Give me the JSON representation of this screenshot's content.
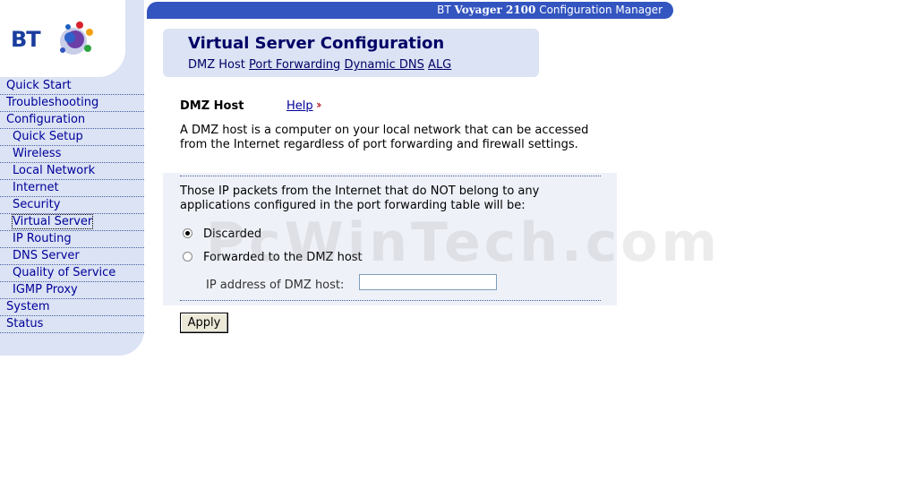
{
  "brand": {
    "logo_text": "BT"
  },
  "titlebar": {
    "prefix": "BT ",
    "product": "Voyager 2100",
    "suffix": " Configuration Manager"
  },
  "sidebar": {
    "items": [
      {
        "label": "Quick Start",
        "level": "top"
      },
      {
        "label": "Troubleshooting",
        "level": "top"
      },
      {
        "label": "Configuration",
        "level": "top"
      },
      {
        "label": "Quick Setup",
        "level": "sub"
      },
      {
        "label": "Wireless",
        "level": "sub"
      },
      {
        "label": "Local Network",
        "level": "sub"
      },
      {
        "label": "Internet",
        "level": "sub"
      },
      {
        "label": "Security",
        "level": "sub"
      },
      {
        "label": "Virtual Server",
        "level": "sub",
        "active": true
      },
      {
        "label": "IP Routing",
        "level": "sub"
      },
      {
        "label": "DNS Server",
        "level": "sub"
      },
      {
        "label": "Quality of Service",
        "level": "sub"
      },
      {
        "label": "IGMP Proxy",
        "level": "sub"
      },
      {
        "label": "System",
        "level": "top"
      },
      {
        "label": "Status",
        "level": "top"
      }
    ]
  },
  "header": {
    "title": "Virtual Server Configuration",
    "tabs": [
      {
        "label": "DMZ Host",
        "current": true
      },
      {
        "label": "Port Forwarding"
      },
      {
        "label": "Dynamic DNS"
      },
      {
        "label": "ALG"
      }
    ]
  },
  "section": {
    "title": "DMZ Host",
    "help_label": "Help",
    "help_icon": "double-chevron-right-icon",
    "description": "A DMZ host is a computer on your local network that can be accessed from the Internet regardless of port forwarding and firewall settings."
  },
  "options": {
    "intro": "Those IP packets from the Internet that do NOT belong to any applications configured in the port forwarding table will be:",
    "discarded_label": "Discarded",
    "forwarded_label": "Forwarded to the DMZ host",
    "selected": "discarded",
    "ip_label": "IP address of DMZ host:",
    "ip_value": ""
  },
  "actions": {
    "apply_label": "Apply"
  },
  "watermark": "PcWinTech.com",
  "colors": {
    "brand_blue": "#3355c0",
    "panel": "#dbe3f4",
    "link": "#000099"
  }
}
